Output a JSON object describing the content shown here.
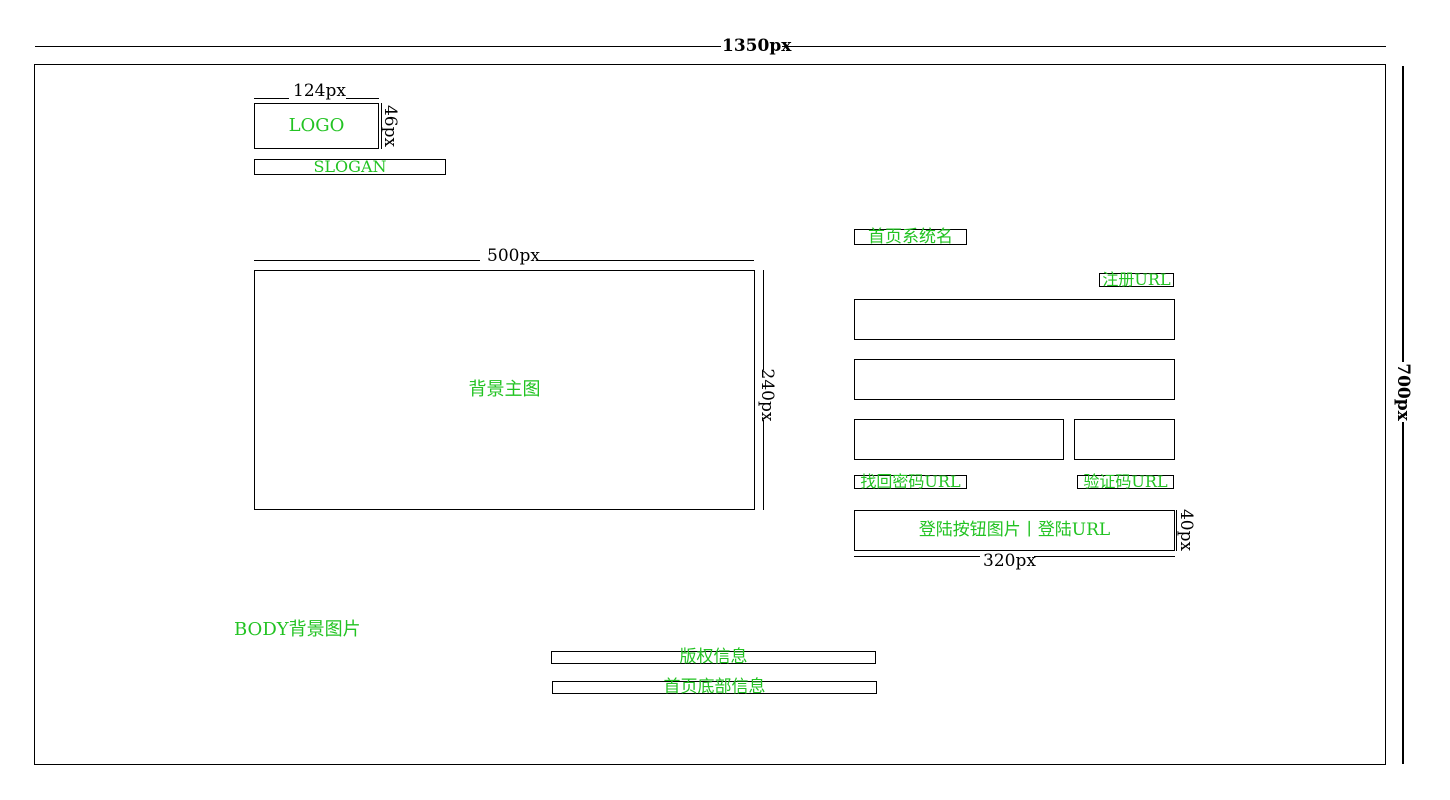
{
  "outer": {
    "width_label": "1350px",
    "height_label": "700px"
  },
  "logo": {
    "label": "LOGO",
    "width_label": "124px",
    "height_label": "46px"
  },
  "slogan": {
    "label": "SLOGAN"
  },
  "main_image": {
    "label": "背景主图",
    "width_label": "500px",
    "height_label": "240px"
  },
  "login": {
    "system_name": "首页系统名",
    "register_url": "注册URL",
    "forgot_password_url": "找回密码URL",
    "captcha_url": "验证码URL",
    "login_button": "登陆按钮图片丨登陆URL",
    "button_height_label": "40px",
    "panel_width_label": "320px"
  },
  "body_bg": {
    "label": "BODY背景图片"
  },
  "footer": {
    "copyright": "版权信息",
    "bottom_info": "首页底部信息"
  },
  "colors": {
    "label_green": "#22c322",
    "line_black": "#000000"
  }
}
